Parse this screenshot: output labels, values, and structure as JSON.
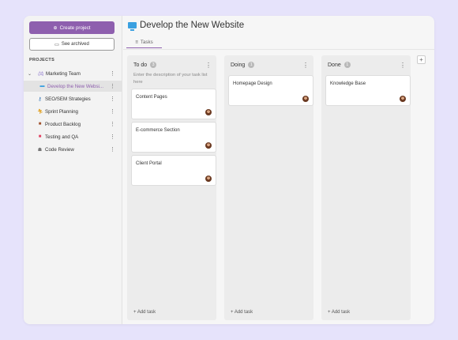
{
  "sidebar": {
    "create_label": "Create project",
    "archived_label": "See archived",
    "projects_heading": "PROJECTS",
    "items": [
      {
        "label": "Marketing Team",
        "icon": "gamepad-icon"
      },
      {
        "label": "Develop the New Websi...",
        "icon": "monitor-icon"
      },
      {
        "label": "SEO/SEM Strategies",
        "icon": "key-icon"
      },
      {
        "label": "Sprint Planning",
        "icon": "runner-icon"
      },
      {
        "label": "Product Backlog",
        "icon": "box-icon"
      },
      {
        "label": "Testing and QA",
        "icon": "badge-icon"
      },
      {
        "label": "Code Review",
        "icon": "robot-icon"
      }
    ]
  },
  "header": {
    "title": "Develop the New Website",
    "icon": "monitor-icon"
  },
  "tabs": [
    {
      "label": "Tasks"
    }
  ],
  "columns": [
    {
      "title": "To do",
      "count": "3",
      "description": "Enter the description of your task list here",
      "cards": [
        {
          "title": "Content Pages"
        },
        {
          "title": "E-commerce Section"
        },
        {
          "title": "Client Portal"
        }
      ],
      "add_label": "+ Add task"
    },
    {
      "title": "Doing",
      "count": "1",
      "cards": [
        {
          "title": "Homepage Design"
        }
      ],
      "add_label": "+ Add task"
    },
    {
      "title": "Done",
      "count": "1",
      "cards": [
        {
          "title": "Knowledge Base"
        }
      ],
      "add_label": "+ Add task"
    }
  ],
  "add_column_label": "+",
  "colors": {
    "accent": "#8e5fae",
    "page_bg": "#e6e3fb"
  }
}
